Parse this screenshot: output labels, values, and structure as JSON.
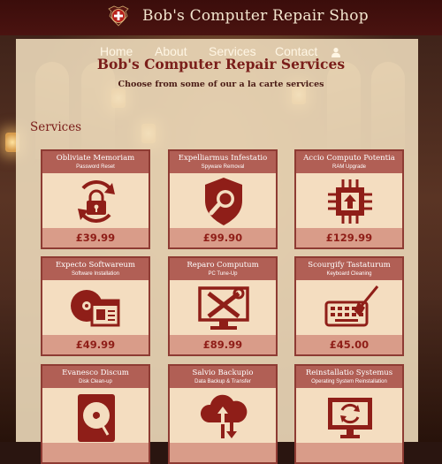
{
  "header": {
    "title": "Bob's Computer Repair Shop",
    "logo_icon": "shield-cross-icon"
  },
  "nav": {
    "items": [
      "Home",
      "About",
      "Services",
      "Contact"
    ],
    "user_icon": "user-icon"
  },
  "main": {
    "title": "Bob's Computer Repair Services",
    "subtitle": "Choose from some of our a la carte services",
    "section_title": "Services"
  },
  "services": [
    {
      "name": "Obliviate Memoriam",
      "desc": "Password Reset",
      "price": "£39.99",
      "icon": "password-reset-lock-icon"
    },
    {
      "name": "Expelliarmus Infestatio",
      "desc": "Spyware Removal",
      "price": "£99.90",
      "icon": "shield-search-icon"
    },
    {
      "name": "Accio Computo Potentia",
      "desc": "RAM Upgrade",
      "price": "£129.99",
      "icon": "chip-upgrade-icon"
    },
    {
      "name": "Expecto Softwareum",
      "desc": "Software Installation",
      "price": "£49.99",
      "icon": "software-install-icon"
    },
    {
      "name": "Reparo Computum",
      "desc": "PC Tune-Up",
      "price": "£89.99",
      "icon": "pc-tools-icon"
    },
    {
      "name": "Scourgify Tastaturum",
      "desc": "Keyboard Cleaning",
      "price": "£45.00",
      "icon": "keyboard-cleaning-icon"
    },
    {
      "name": "Evanesco Discum",
      "desc": "Disk Clean-up",
      "price": "",
      "icon": "hard-disk-icon"
    },
    {
      "name": "Salvio Backupio",
      "desc": "Data Backup & Transfer",
      "price": "",
      "icon": "cloud-backup-icon"
    },
    {
      "name": "Reinstallatio Systemus",
      "desc": "Operating System Reinstallation",
      "price": "",
      "icon": "monitor-reinstall-icon"
    }
  ],
  "colors": {
    "accent": "#7a1e1a",
    "card_head": "#b15f55",
    "card_body": "#f4ddc0",
    "card_foot": "#d99c89",
    "navbar": "#3b0d0b"
  }
}
